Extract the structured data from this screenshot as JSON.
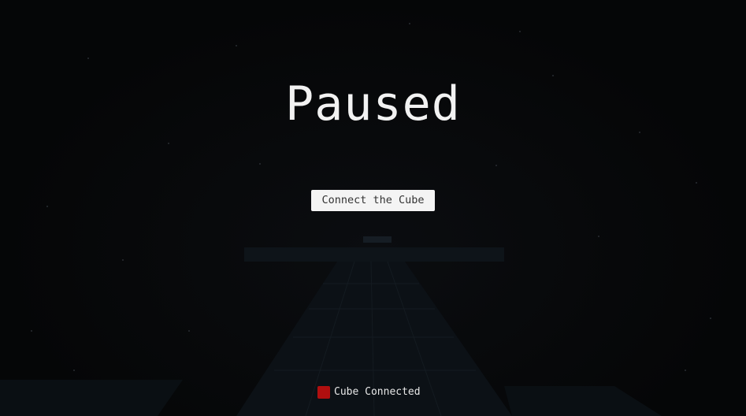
{
  "pause_screen": {
    "title": "Paused",
    "connect_button_label": "Connect the Cube"
  },
  "status_bar": {
    "text": "Cube Connected",
    "indicator_color": "#b00f0f",
    "indicator_icon": "red-square-status-icon"
  },
  "scene": {
    "background_color": "#050607",
    "track_color": "#0c1116",
    "star_color": "#2a2e33"
  }
}
